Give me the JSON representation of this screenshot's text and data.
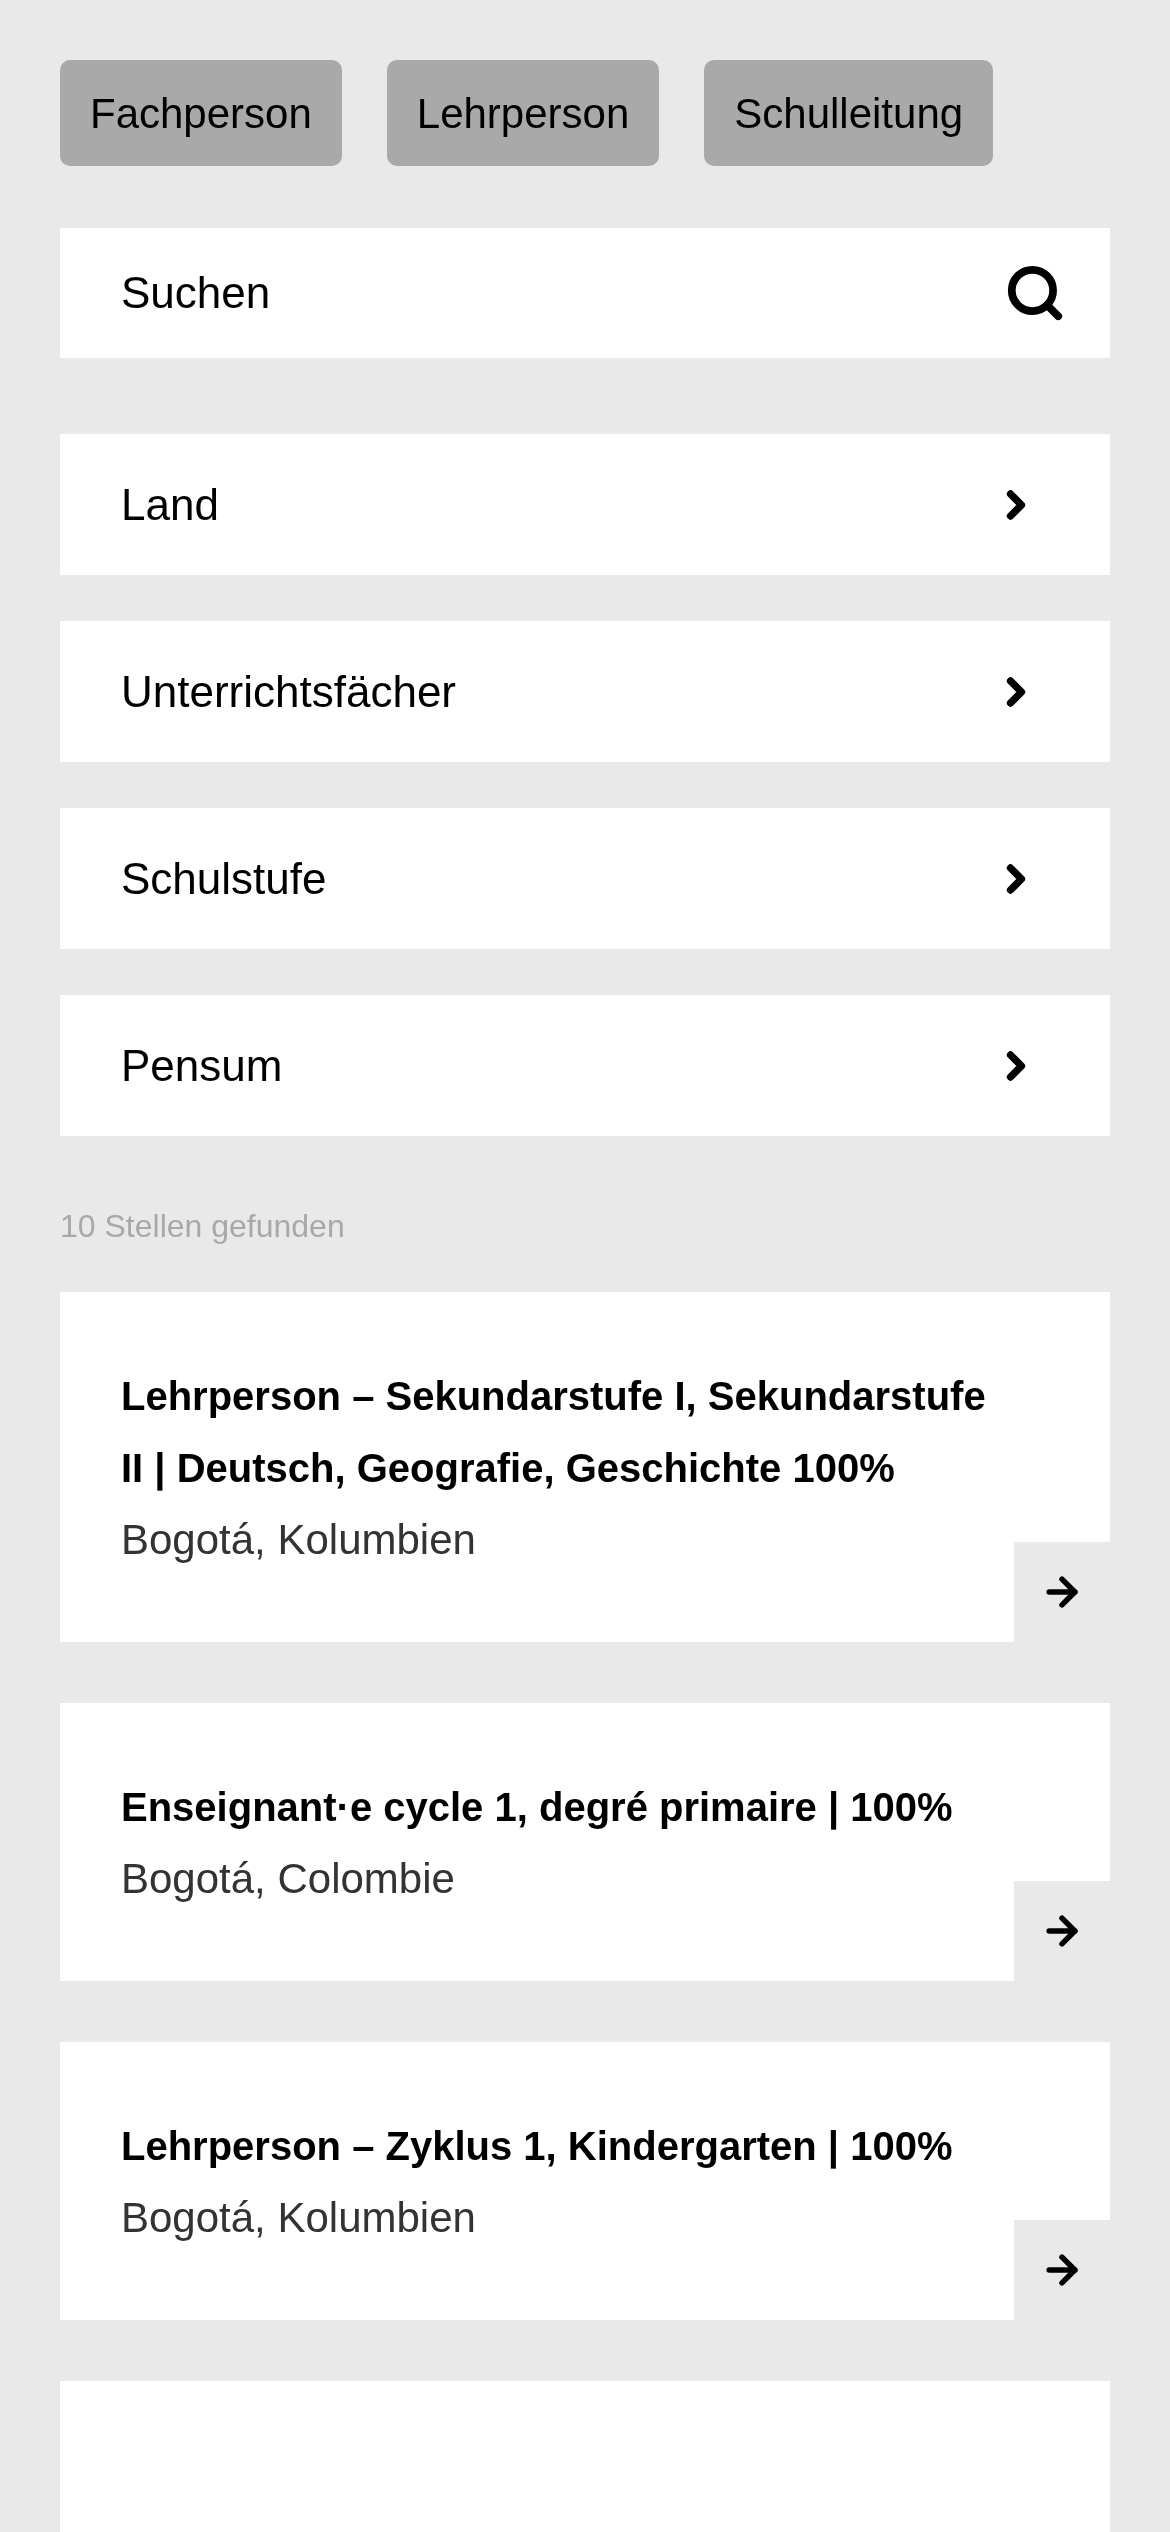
{
  "role_buttons": [
    "Fachperson",
    "Lehrperson",
    "Schulleitung"
  ],
  "search": {
    "placeholder": "Suchen"
  },
  "filters": [
    "Land",
    "Unterrichtsfächer",
    "Schulstufe",
    "Pensum"
  ],
  "result_count": "10 Stellen gefunden",
  "results": [
    {
      "title": "Lehrperson – Sekundarstufe I, Sekundarstufe II | Deutsch, Geografie, Geschichte 100%",
      "location": "Bogotá, Kolumbien"
    },
    {
      "title": "Enseignant·e cycle 1, degré primaire | 100%",
      "location": "Bogotá, Colombie"
    },
    {
      "title": "Lehrperson – Zyklus 1, Kindergarten | 100%",
      "location": "Bogotá, Kolumbien"
    }
  ]
}
